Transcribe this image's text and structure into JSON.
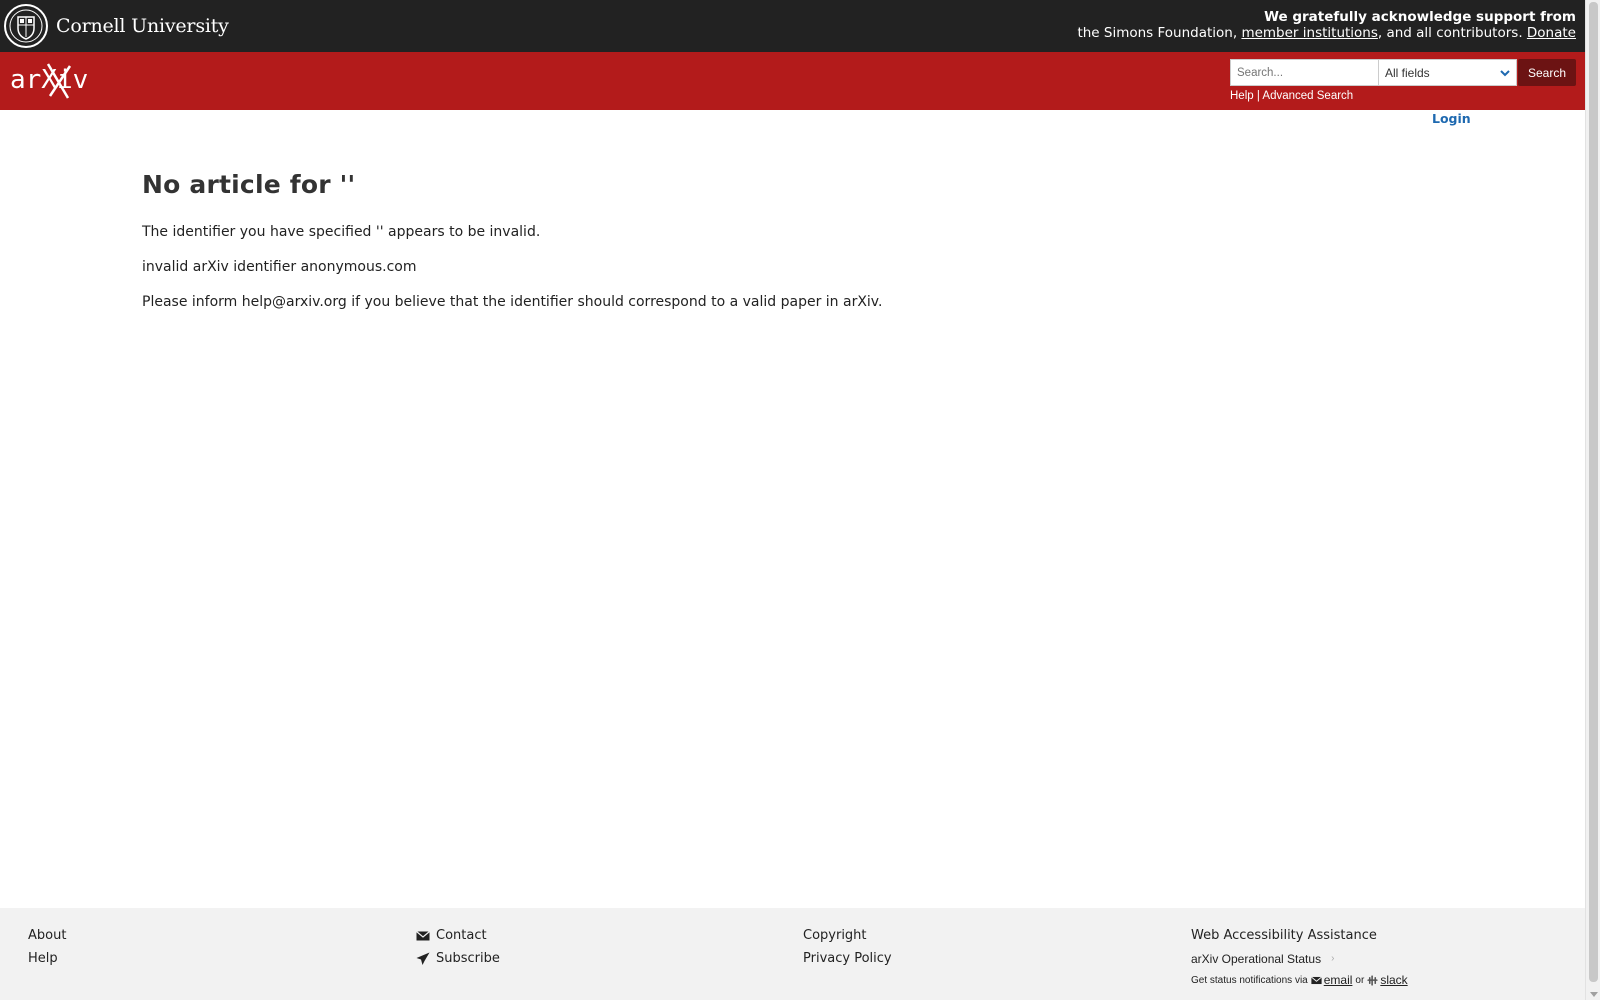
{
  "cornell": {
    "name": "Cornell University"
  },
  "support": {
    "line1": "We gratefully acknowledge support from",
    "line2_prefix": "the Simons Foundation, ",
    "member_institutions": "member institutions",
    "line2_middle": ", and all contributors. ",
    "donate": "Donate"
  },
  "header": {
    "logo_text": "arXiv",
    "search_placeholder": "Search...",
    "search_field_selected": "All fields",
    "search_button": "Search",
    "help_link": "Help",
    "separator": " | ",
    "advanced_search_link": "Advanced Search",
    "login": "Login"
  },
  "main": {
    "title": "No article for ''",
    "messages": [
      "The identifier you have specified '' appears to be invalid.",
      "invalid arXiv identifier anonymous.com",
      "Please inform help@arxiv.org if you believe that the identifier should correspond to a valid paper in arXiv."
    ]
  },
  "footer": {
    "about": "About",
    "help": "Help",
    "contact": "Contact",
    "subscribe": "Subscribe",
    "copyright": "Copyright",
    "privacy": "Privacy Policy",
    "accessibility": "Web Accessibility Assistance",
    "operational_status": "arXiv Operational Status",
    "status_chevron": "›",
    "notify_prefix": "Get status notifications via",
    "notify_email": "email",
    "notify_or": "or",
    "notify_slack": "slack"
  },
  "colors": {
    "arxiv_red": "#b31b1b",
    "cornell_bar": "#222222",
    "search_button": "#6c1313",
    "login_link": "#1e69b0",
    "footer_bg": "#f2f2f2"
  },
  "icons": {
    "cornell": "cornell-seal-icon",
    "search_chevron": "chevron-down-icon",
    "contact": "envelope-icon",
    "subscribe": "paper-plane-icon",
    "email": "envelope-icon",
    "slack": "slack-icon"
  }
}
